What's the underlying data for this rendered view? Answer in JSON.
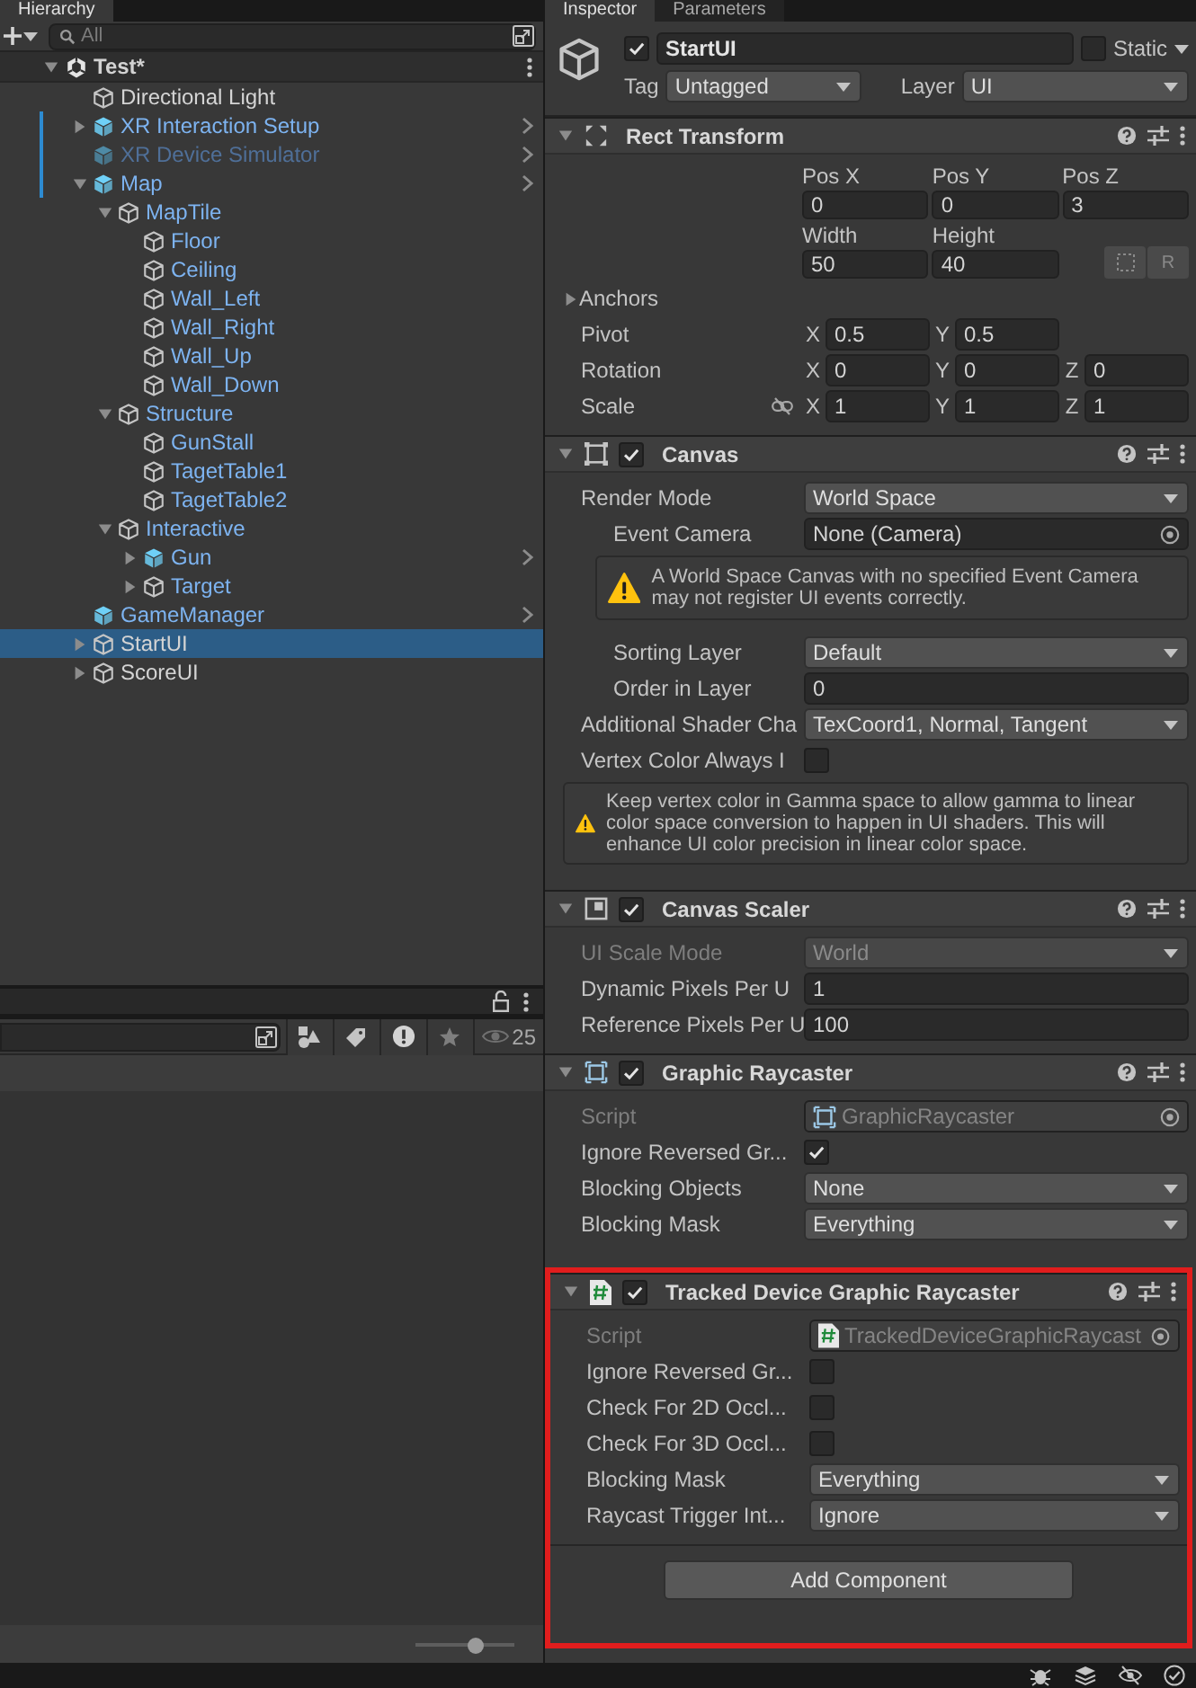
{
  "hierarchy": {
    "tab": {
      "label": "Hierarchy",
      "selected": true
    },
    "search": {
      "placeholder": "All"
    },
    "scene": {
      "name": "Test*",
      "expanded": true
    },
    "items": [
      {
        "name": "Directional Light",
        "kind": "object",
        "chevron": false,
        "marked": false,
        "selected": false
      },
      {
        "name": "XR Interaction Setup",
        "kind": "prefab",
        "expanded": false,
        "chevron": true,
        "marked": true,
        "selected": false
      },
      {
        "name": "XR Device Simulator",
        "kind": "prefab_inactive",
        "chevron": true,
        "marked": true,
        "selected": false
      },
      {
        "name": "Map",
        "kind": "prefab",
        "expanded": true,
        "chevron": true,
        "marked": true,
        "selected": false,
        "children": [
          {
            "name": "MapTile",
            "kind": "prefab_part",
            "expanded": true,
            "chevron": false,
            "marked": false,
            "selected": false,
            "children": [
              {
                "name": "Floor",
                "kind": "prefab_part",
                "chevron": false,
                "marked": false,
                "selected": false
              },
              {
                "name": "Ceiling",
                "kind": "prefab_part",
                "chevron": false,
                "marked": false,
                "selected": false
              },
              {
                "name": "Wall_Left",
                "kind": "prefab_part",
                "chevron": false,
                "marked": false,
                "selected": false
              },
              {
                "name": "Wall_Right",
                "kind": "prefab_part",
                "chevron": false,
                "marked": false,
                "selected": false
              },
              {
                "name": "Wall_Up",
                "kind": "prefab_part",
                "chevron": false,
                "marked": false,
                "selected": false
              },
              {
                "name": "Wall_Down",
                "kind": "prefab_part",
                "chevron": false,
                "marked": false,
                "selected": false
              }
            ]
          },
          {
            "name": "Structure",
            "kind": "prefab_part",
            "expanded": true,
            "chevron": false,
            "marked": false,
            "selected": false,
            "children": [
              {
                "name": "GunStall",
                "kind": "prefab_part",
                "chevron": false,
                "marked": false,
                "selected": false
              },
              {
                "name": "TagetTable1",
                "kind": "prefab_part",
                "chevron": false,
                "marked": false,
                "selected": false
              },
              {
                "name": "TagetTable2",
                "kind": "prefab_part",
                "chevron": false,
                "marked": false,
                "selected": false
              }
            ]
          },
          {
            "name": "Interactive",
            "kind": "prefab_part",
            "expanded": true,
            "chevron": false,
            "marked": false,
            "selected": false,
            "children": [
              {
                "name": "Gun",
                "kind": "prefab",
                "expanded": false,
                "chevron": true,
                "marked": false,
                "selected": false
              },
              {
                "name": "Target",
                "kind": "prefab_part",
                "expanded": false,
                "chevron": false,
                "marked": false,
                "selected": false
              }
            ]
          }
        ]
      },
      {
        "name": "GameManager",
        "kind": "prefab",
        "chevron": true,
        "marked": false,
        "selected": false
      },
      {
        "name": "StartUI",
        "kind": "object",
        "expanded": false,
        "chevron": false,
        "marked": false,
        "selected": true
      },
      {
        "name": "ScoreUI",
        "kind": "object",
        "expanded": false,
        "chevron": false,
        "marked": false,
        "selected": false
      }
    ]
  },
  "project": {
    "count": "25",
    "zoom": {
      "level": 0.6
    }
  },
  "inspector": {
    "tabs": [
      {
        "label": "Inspector",
        "selected": true
      },
      {
        "label": "Parameters",
        "selected": false
      }
    ],
    "object": {
      "active": true,
      "name": "StartUI",
      "static": false,
      "static_label": "Static",
      "tag_label": "Tag",
      "tag": "Untagged",
      "layer_label": "Layer",
      "layer": "UI"
    },
    "components": [
      {
        "title": "Rect Transform",
        "kind": "rect_transform",
        "expanded": true,
        "highlighted": false,
        "rows": [
          {
            "kind": "grid",
            "cells": [
              {
                "caption": "Pos X",
                "value": "0"
              },
              {
                "caption": "Pos Y",
                "value": "0"
              },
              {
                "caption": "Pos Z",
                "value": "3"
              }
            ]
          },
          {
            "kind": "grid",
            "cells": [
              {
                "caption": "Width",
                "value": "50"
              },
              {
                "caption": "Height",
                "value": "40"
              }
            ],
            "buttons": [
              "R"
            ]
          },
          {
            "kind": "foldout",
            "label": "Anchors",
            "expanded": false
          },
          {
            "kind": "vector",
            "label": "Pivot",
            "fields": [
              {
                "axis": "X",
                "value": "0.5"
              },
              {
                "axis": "Y",
                "value": "0.5"
              }
            ]
          },
          {
            "kind": "vector",
            "label": "Rotation",
            "fields": [
              {
                "axis": "X",
                "value": "0"
              },
              {
                "axis": "Y",
                "value": "0"
              },
              {
                "axis": "Z",
                "value": "0"
              }
            ]
          },
          {
            "kind": "vector",
            "label": "Scale",
            "constrained": false,
            "fields": [
              {
                "axis": "X",
                "value": "1"
              },
              {
                "axis": "Y",
                "value": "1"
              },
              {
                "axis": "Z",
                "value": "1"
              }
            ]
          }
        ]
      },
      {
        "title": "Canvas",
        "kind": "canvas",
        "enabled": true,
        "expanded": true,
        "highlighted": false,
        "rows": [
          {
            "kind": "dropdown",
            "label": "Render Mode",
            "value": "World Space",
            "disabled": false,
            "children": [
              {
                "kind": "object",
                "label": "Event Camera",
                "value": "None (Camera)",
                "disabled": false
              },
              {
                "kind": "help",
                "text": "A World Space Canvas with no specified Event Camera may not register UI events correctly."
              },
              {
                "kind": "dropdown",
                "label": "Sorting Layer",
                "value": "Default",
                "disabled": false
              },
              {
                "kind": "text",
                "label": "Order in Layer",
                "value": "0",
                "disabled": false
              }
            ]
          },
          {
            "kind": "dropdown",
            "label": "Additional Shader Cha",
            "value": "TexCoord1, Normal, Tangent",
            "disabled": false
          },
          {
            "kind": "checkbox",
            "label": "Vertex Color Always I",
            "checked": false
          },
          {
            "kind": "help",
            "text": "Keep vertex color in Gamma space to allow gamma to linear color space conversion to happen in UI shaders. This will enhance UI color precision in linear color space."
          }
        ]
      },
      {
        "title": "Canvas Scaler",
        "kind": "canvas_scaler",
        "enabled": true,
        "expanded": true,
        "highlighted": false,
        "rows": [
          {
            "kind": "dropdown",
            "label": "UI Scale Mode",
            "value": "World",
            "disabled": true
          },
          {
            "kind": "text",
            "label": "Dynamic Pixels Per U",
            "value": "1",
            "disabled": false
          },
          {
            "kind": "text",
            "label": "Reference Pixels Per U",
            "value": "100",
            "disabled": false
          }
        ]
      },
      {
        "title": "Graphic Raycaster",
        "kind": "raycaster",
        "enabled": true,
        "expanded": true,
        "highlighted": false,
        "rows": [
          {
            "kind": "script",
            "label": "Script",
            "value": "GraphicRaycaster",
            "disabled": true
          },
          {
            "kind": "checkbox",
            "label": "Ignore Reversed Gr...",
            "checked": true
          },
          {
            "kind": "dropdown",
            "label": "Blocking Objects",
            "value": "None",
            "disabled": false
          },
          {
            "kind": "dropdown",
            "label": "Blocking Mask",
            "value": "Everything",
            "disabled": false
          }
        ]
      },
      {
        "title": "Tracked Device Graphic Raycaster",
        "kind": "script",
        "enabled": true,
        "expanded": true,
        "highlighted": true,
        "rows": [
          {
            "kind": "script",
            "label": "Script",
            "value": "TrackedDeviceGraphicRaycast",
            "disabled": true
          },
          {
            "kind": "checkbox",
            "label": "Ignore Reversed Gr...",
            "checked": false
          },
          {
            "kind": "checkbox",
            "label": "Check For 2D Occl...",
            "checked": false
          },
          {
            "kind": "checkbox",
            "label": "Check For 3D Occl...",
            "checked": false
          },
          {
            "kind": "dropdown",
            "label": "Blocking Mask",
            "value": "Everything",
            "disabled": false
          },
          {
            "kind": "dropdown",
            "label": "Raycast Trigger Int...",
            "value": "Ignore",
            "disabled": false
          }
        ]
      }
    ],
    "add_component": "Add Component"
  }
}
